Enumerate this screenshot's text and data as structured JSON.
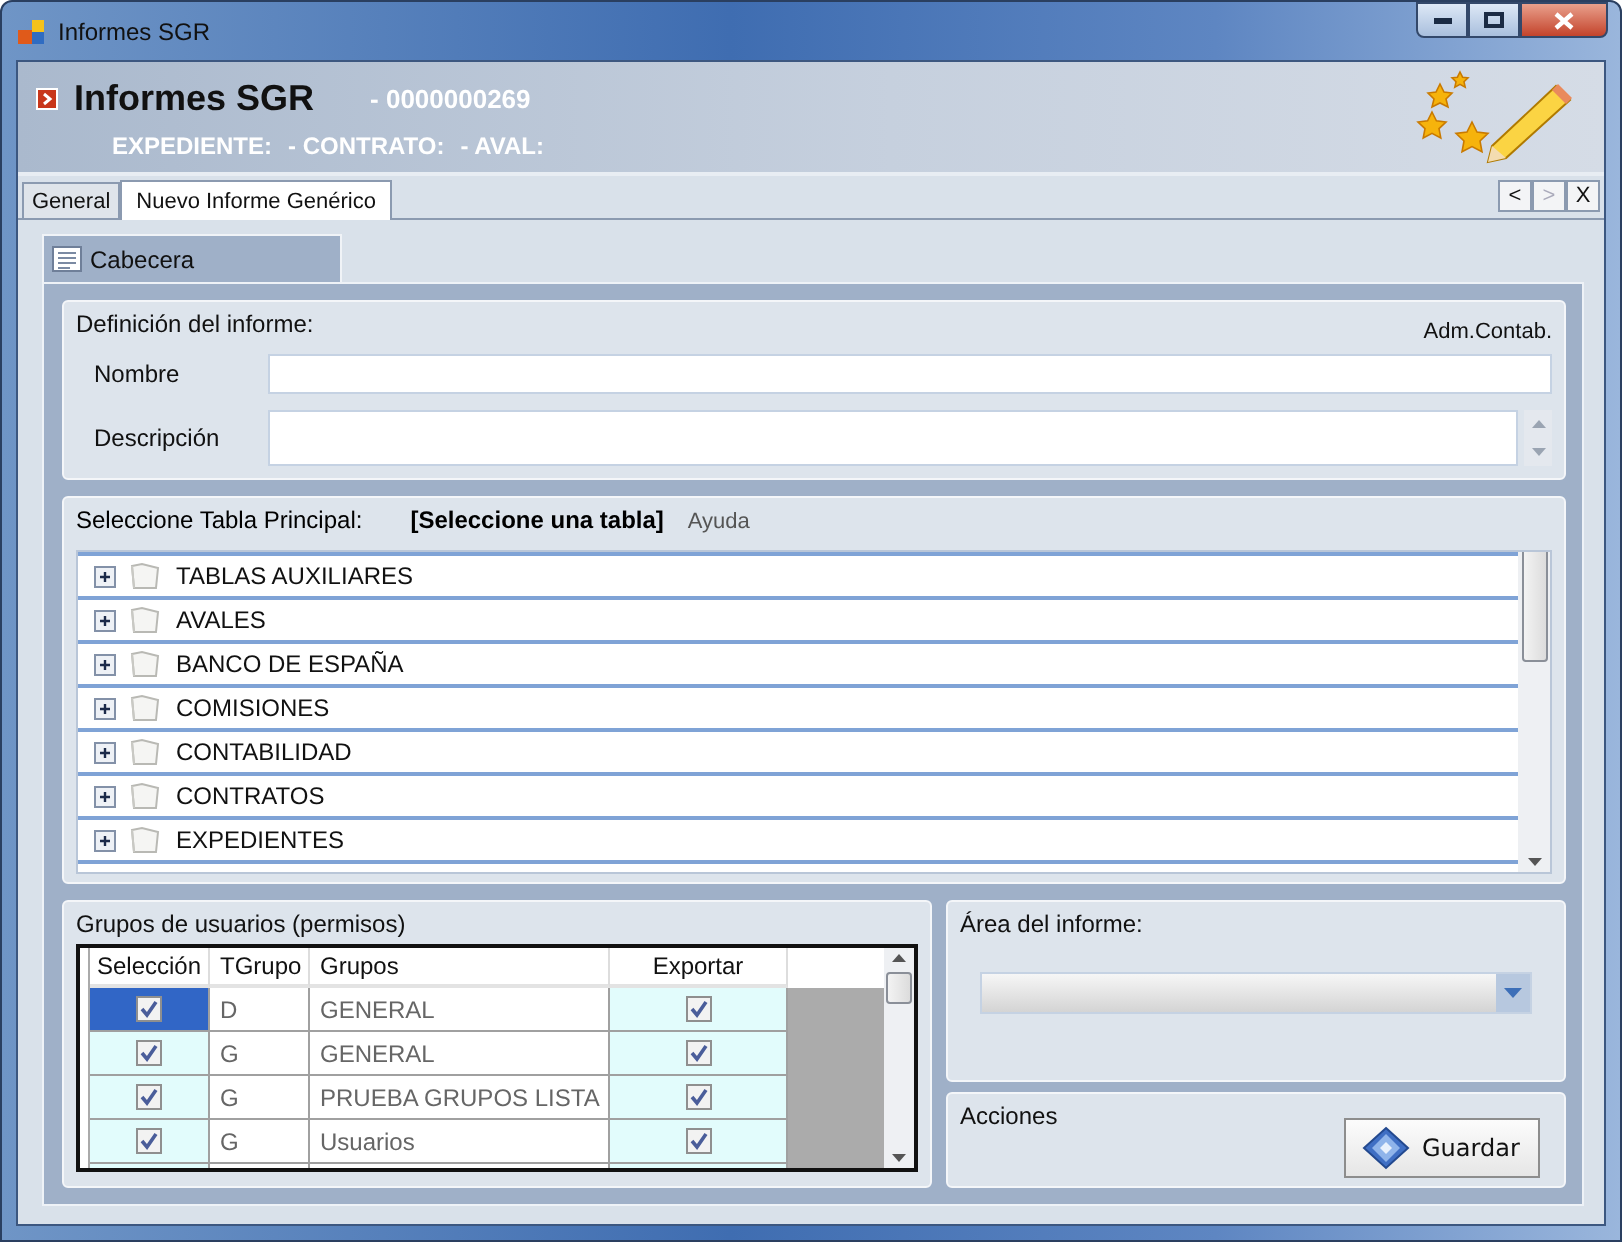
{
  "window": {
    "title": "Informes SGR"
  },
  "header": {
    "title": "Informes SGR",
    "number": "- 0000000269",
    "fields": [
      "EXPEDIENTE:",
      "- CONTRATO:",
      "- AVAL:"
    ]
  },
  "tabs": [
    {
      "label": "General",
      "selected": false
    },
    {
      "label": "Nuevo Informe Genérico",
      "selected": true
    }
  ],
  "tab_nav": [
    {
      "label": "<",
      "disabled": false
    },
    {
      "label": ">",
      "disabled": true
    },
    {
      "label": "X",
      "disabled": false
    }
  ],
  "subtabs": [
    {
      "label": "Cabecera",
      "selected": true
    }
  ],
  "definition": {
    "title": "Definición del informe:",
    "badge": "Adm.Contab.",
    "fields": [
      {
        "label": "Nombre",
        "kind": "single"
      },
      {
        "label": "Descripción",
        "kind": "multi"
      }
    ]
  },
  "table_picker": {
    "label": "Seleccione Tabla Principal:",
    "value": "[Seleccione una tabla]",
    "help": "Ayuda",
    "items": [
      {
        "label": "TABLAS AUXILIARES",
        "expanded": false
      },
      {
        "label": "AVALES",
        "expanded": false
      },
      {
        "label": "BANCO DE ESPAÑA",
        "expanded": false
      },
      {
        "label": "COMISIONES",
        "expanded": false
      },
      {
        "label": "CONTABILIDAD",
        "expanded": false
      },
      {
        "label": "CONTRATOS",
        "expanded": false
      },
      {
        "label": "EXPEDIENTES",
        "expanded": false
      }
    ]
  },
  "groups": {
    "title": "Grupos de usuarios (permisos)",
    "columns": [
      "Selección",
      "TGrupo",
      "Grupos",
      "Exportar"
    ],
    "rows": [
      {
        "checked": true,
        "type": "D",
        "group": "GENERAL",
        "export": true,
        "selected": true
      },
      {
        "checked": true,
        "type": "G",
        "group": "GENERAL",
        "export": true,
        "selected": false
      },
      {
        "checked": true,
        "type": "G",
        "group": "PRUEBA GRUPOS LISTA",
        "export": true,
        "selected": false
      },
      {
        "checked": true,
        "type": "G",
        "group": "Usuarios",
        "export": true,
        "selected": false
      }
    ]
  },
  "area": {
    "title": "Área del informe:"
  },
  "actions": {
    "title": "Acciones",
    "buttons": [
      "Guardar"
    ]
  }
}
